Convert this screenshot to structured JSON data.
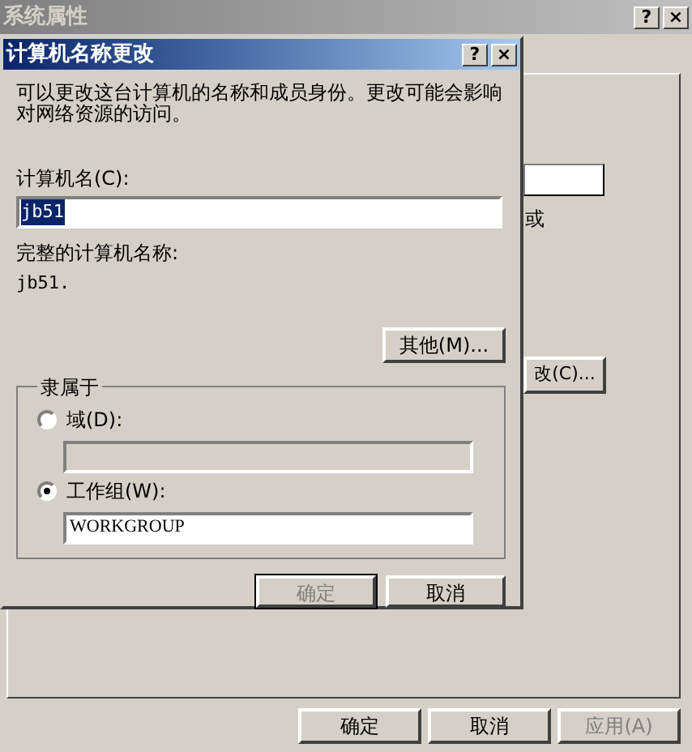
{
  "back_window": {
    "title": "系统属性",
    "help": "?",
    "close": "×",
    "field_text": "或",
    "change_button": {
      "label": "改(C)...",
      "disabled": false
    },
    "buttons": [
      {
        "label": "确定",
        "disabled": false
      },
      {
        "label": "取消",
        "disabled": false
      },
      {
        "label": "应用(A)",
        "disabled": true
      }
    ]
  },
  "dialog": {
    "title": "计算机名称更改",
    "help": "?",
    "close": "×",
    "description": "可以更改这台计算机的名称和成员身份。更改可能会影响对网络资源的访问。",
    "computer_name": {
      "label": "计算机名(C):",
      "value": "jb51",
      "selected": true
    },
    "full_name": {
      "label": "完整的计算机名称:",
      "value": "jb51."
    },
    "more_button": {
      "label": "其他(M)...",
      "disabled": false
    },
    "member_of": {
      "label": "隶属于",
      "options": [
        {
          "label": "域(D):",
          "selected": false
        },
        {
          "label": "工作组(W):",
          "selected": true,
          "value": "WORKGROUP"
        }
      ]
    },
    "buttons": [
      {
        "label": "确定",
        "disabled": true,
        "default": true
      },
      {
        "label": "取消",
        "disabled": false,
        "default": false
      }
    ]
  }
}
